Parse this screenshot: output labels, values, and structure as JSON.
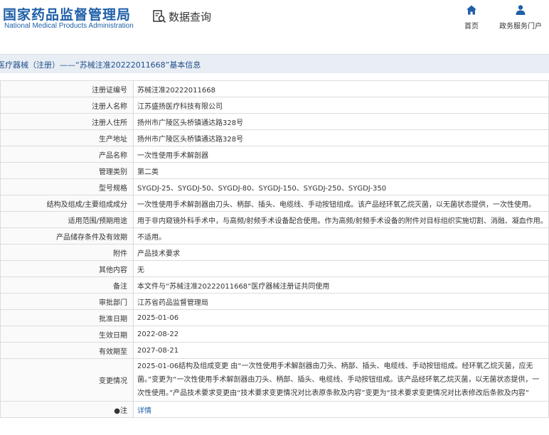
{
  "header": {
    "logo_cn": "国家药品监督管理局",
    "logo_en": "National Medical Products Administration",
    "query_label": "数据查询",
    "nav": [
      {
        "label": "首页"
      },
      {
        "label": "政务服务门户"
      }
    ]
  },
  "breadcrumb": "医疗器械（注册）——“苏械注准20222011668”基本信息",
  "rows": [
    {
      "key": "注册证编号",
      "value": "苏械注准20222011668"
    },
    {
      "key": "注册人名称",
      "value": "江苏盛扬医疗科技有限公司"
    },
    {
      "key": "注册人住所",
      "value": "扬州市广陵区头桥镇通达路328号"
    },
    {
      "key": "生产地址",
      "value": "扬州市广陵区头桥镇通达路328号"
    },
    {
      "key": "产品名称",
      "value": "一次性使用手术解剖器"
    },
    {
      "key": "管理类别",
      "value": "第二类"
    },
    {
      "key": "型号规格",
      "value": "SYGDJ-25、SYGDJ-50、SYGDJ-80、SYGDJ-150、SYGDJ-250、SYGDJ-350"
    },
    {
      "key": "结构及组成/主要组成成分",
      "value": "一次性使用手术解剖器由刀头、柄部、插头、电缆线、手动按钮组成。该产品经环氧乙烷灭菌，以无菌状态提供，一次性使用。"
    },
    {
      "key": "适用范围/预期用途",
      "value": "用于非内窥镜外科手术中，与高频/射频手术设备配合使用。作为高频/射频手术设备的附件对目标组织实施切割、消融、凝血作用。"
    },
    {
      "key": "产品储存条件及有效期",
      "value": "不适用。"
    },
    {
      "key": "附件",
      "value": "产品技术要求"
    },
    {
      "key": "其他内容",
      "value": "无"
    },
    {
      "key": "备注",
      "value": "本文件与“苏械注准20222011668”医疗器械注册证共同使用"
    },
    {
      "key": "审批部门",
      "value": "江苏省药品监督管理局"
    },
    {
      "key": "批准日期",
      "value": "2025-01-06"
    },
    {
      "key": "生效日期",
      "value": "2022-08-22"
    },
    {
      "key": "有效期至",
      "value": "2027-08-21"
    },
    {
      "key": "变更情况",
      "value": "2025-01-06结构及组成变更 由“一次性使用手术解剖器由刀头、柄部、插头、电缆线、手动按钮组成。经环氧乙烷灭菌，应无菌。”变更为“一次性使用手术解剖器由刀头、柄部、插头、电缆线、手动按钮组成。该产品经环氧乙烷灭菌，以无菌状态提供，一次性使用。”产品技术要求变更由“技术要求变更情况对比表原条款及内容”变更为“技术要求变更情况对比表修改后条款及内容”"
    },
    {
      "key": "●注",
      "value": "详情"
    }
  ],
  "colors": {
    "brand_blue": "#1f5fa8",
    "breadcrumb_bg": "#e9eef4",
    "link": "#1f5fa8"
  },
  "icons": {
    "query": "magnifier-document-icon",
    "home": "home-icon",
    "gov": "user-icon"
  }
}
